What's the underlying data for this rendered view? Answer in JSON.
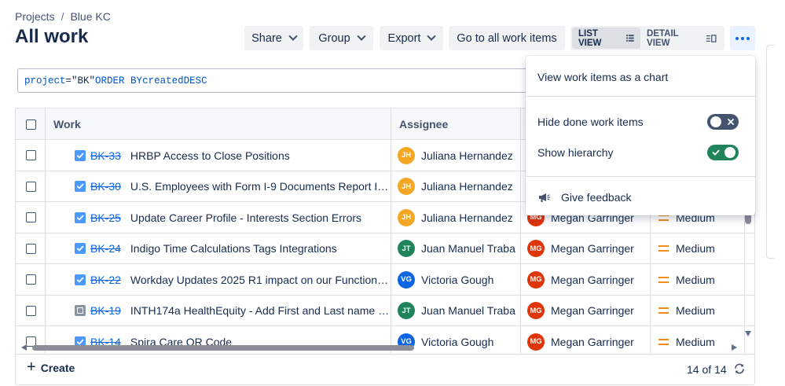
{
  "breadcrumb": {
    "projects": "Projects",
    "separator": "/",
    "project": "Blue KC"
  },
  "page_title": "All work",
  "toolbar": {
    "share": "Share",
    "group": "Group",
    "export": "Export",
    "go_to_all": "Go to all work items",
    "list_view": "LIST VIEW",
    "detail_view": "DETAIL VIEW",
    "more_icon": "more-horizontal-icon"
  },
  "jql": {
    "field": "project",
    "op": "=",
    "value": "\"BK\"",
    "order": "ORDER BY",
    "order_field": "created",
    "direction": "DESC"
  },
  "table": {
    "columns": {
      "work": "Work",
      "assignee": "Assignee"
    },
    "rows": [
      {
        "type": "task",
        "key": "BK-33",
        "summary": "HRBP Access to Close Positions",
        "assignee": {
          "initials": "JH",
          "name": "Juliana Hernandez",
          "color": "#f5a623"
        },
        "reporter": null,
        "priority": null
      },
      {
        "type": "task",
        "key": "BK-30",
        "summary": "U.S. Employees with Form I-9 Documents Report Iss...",
        "assignee": {
          "initials": "JH",
          "name": "Juliana Hernandez",
          "color": "#f5a623"
        },
        "reporter": null,
        "priority": null
      },
      {
        "type": "task",
        "key": "BK-25",
        "summary": "Update Career Profile - Interests Section Errors",
        "assignee": {
          "initials": "JH",
          "name": "Juliana Hernandez",
          "color": "#f5a623"
        },
        "reporter": {
          "initials": "MG",
          "name": "Megan Garringer",
          "color": "#de350b"
        },
        "priority": "Medium"
      },
      {
        "type": "task",
        "key": "BK-24",
        "summary": "Indigo Time Calculations Tags Integrations",
        "assignee": {
          "initials": "JT",
          "name": "Juan Manuel Traba",
          "color": "#1f845a"
        },
        "reporter": {
          "initials": "MG",
          "name": "Megan Garringer",
          "color": "#de350b"
        },
        "priority": "Medium"
      },
      {
        "type": "task",
        "key": "BK-22",
        "summary": "Workday Updates 2025 R1 impact on our Functional ...",
        "assignee": {
          "initials": "VG",
          "name": "Victoria Gough",
          "color": "#0c66e4"
        },
        "reporter": {
          "initials": "MG",
          "name": "Megan Garringer",
          "color": "#de350b"
        },
        "priority": "Medium"
      },
      {
        "type": "subtask",
        "key": "BK-19",
        "summary": "INTH174a HealthEquity - Add First and Last name to...",
        "assignee": {
          "initials": "JT",
          "name": "Juan Manuel Traba",
          "color": "#1f845a"
        },
        "reporter": {
          "initials": "MG",
          "name": "Megan Garringer",
          "color": "#de350b"
        },
        "priority": "Medium"
      },
      {
        "type": "task",
        "key": "BK-14",
        "summary": "Spira Care OR Code",
        "assignee": {
          "initials": "VG",
          "name": "Victoria Gough",
          "color": "#0c66e4"
        },
        "reporter": {
          "initials": "MG",
          "name": "Megan Garringer",
          "color": "#de350b"
        },
        "priority": "Medium"
      }
    ]
  },
  "footer": {
    "create": "Create",
    "count": "14 of 14",
    "refresh_icon": "refresh-icon"
  },
  "menu": {
    "chart": "View work items as a chart",
    "hide_done": "Hide done work items",
    "hide_done_enabled": false,
    "show_hierarchy": "Show hierarchy",
    "show_hierarchy_enabled": true,
    "feedback": "Give feedback",
    "feedback_icon": "megaphone-icon"
  },
  "colors": {
    "accent": "#0c66e4",
    "toggle_on": "#1f845a",
    "toggle_off": "#44546f",
    "priority_medium": "#f18c1f"
  }
}
